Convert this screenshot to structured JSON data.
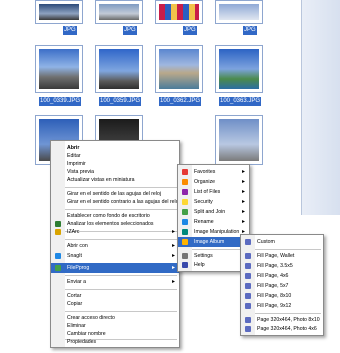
{
  "thumbnails": [
    {
      "caption": "100_0339.JPG",
      "scene": "las-vegas-strip-photo"
    },
    {
      "caption": "100_0359.JPG",
      "scene": "las-vegas-tower-photo"
    },
    {
      "caption": "100_0362.JPG",
      "scene": "venetian-canal-photo"
    },
    {
      "caption": "100_0363.JPG",
      "scene": "pool-and-palms-photo"
    }
  ],
  "top_captions": [
    "JPG",
    "JPG",
    "JPG",
    "JPG"
  ],
  "context_menu": {
    "items": [
      {
        "label": "Abrir",
        "bold": true
      },
      {
        "label": "Editar"
      },
      {
        "label": "Imprimir"
      },
      {
        "label": "Vista previa"
      },
      {
        "label": "Actualizar vistas en miniatura"
      },
      {
        "label": "Girar en el sentido de las agujas del reloj"
      },
      {
        "label": "Girar en el sentido contrario a las agujas del reloj"
      },
      {
        "label": "Establecer como fondo de escritorio"
      },
      {
        "label": "Analizar los elementos seleccionados"
      },
      {
        "label": "Abrir con"
      },
      {
        "label": "SnagIt"
      },
      {
        "label": "FilePprog"
      },
      {
        "label": "Enviar a"
      },
      {
        "label": "Cortar"
      },
      {
        "label": "Copiar"
      },
      {
        "label": "Crear acceso directo"
      },
      {
        "label": "Eliminar"
      },
      {
        "label": "Cambiar nombre"
      },
      {
        "label": "Propiedades"
      }
    ],
    "partial_label": "IZArc"
  },
  "fileprog_menu": {
    "items": [
      "Favorites",
      "Organize",
      "List of Files",
      "Security",
      "Split and Join",
      "Rename",
      "Image Manipulation",
      "Image Album",
      "Settings",
      "Help"
    ]
  },
  "album_menu": {
    "items": [
      "Custom",
      "Fill Page, Wallet",
      "Fill Page, 3.5x5",
      "Fill Page, 4x6",
      "Fill Page, 5x7",
      "Fill Page, 8x10",
      "Fill Page, 9x12",
      "Page 320x464, Photo 8x10",
      "Page 320x464, Photo 4x6"
    ]
  },
  "colors": {
    "selection": "#316ac5",
    "caption_bg": "#3168c6"
  }
}
